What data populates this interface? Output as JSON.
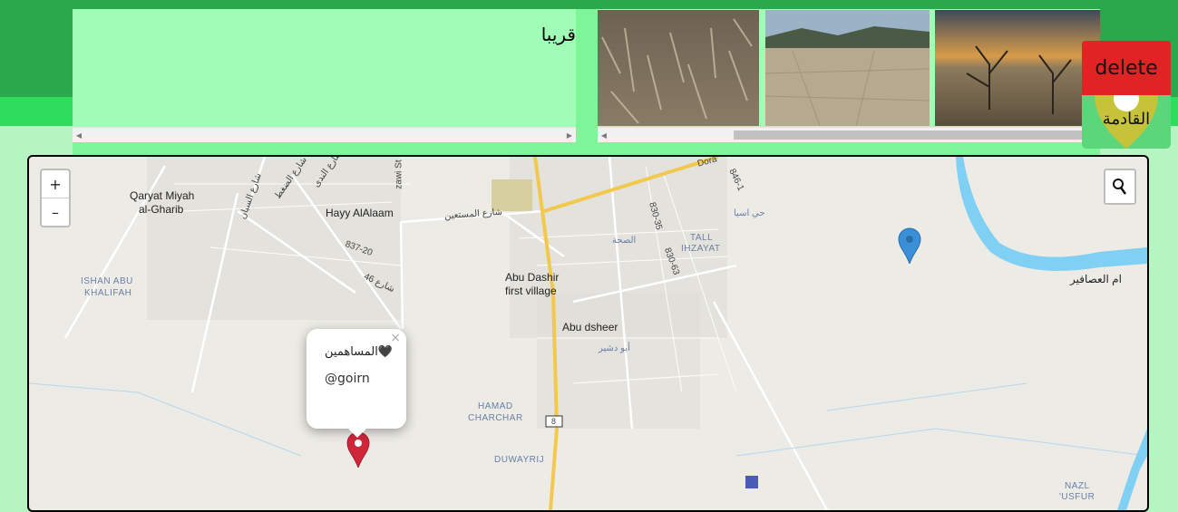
{
  "header": {
    "text_label": "قريبا",
    "delete_label": "delete",
    "coming_label": "القادمة"
  },
  "gallery": {
    "photos": [
      "dry-cracked-field-photo",
      "dry-lake-bed-photo",
      "dead-trees-sunset-photo"
    ]
  },
  "map": {
    "zoom_in": "+",
    "zoom_out": "–",
    "popup": {
      "close": "×",
      "title": "المساهمين🖤",
      "handle": "@goirn"
    },
    "labels": {
      "qaryat": "Qaryat Miyah",
      "qaryat2": "al-Gharib",
      "hayy": "Hayy AlAlaam",
      "abudashir": "Abu Dashir",
      "abudashir2": "first village",
      "abudsheer": "Abu dsheer",
      "abudsheer_ar": "أبو دشير",
      "ishan": "ISHAN ABU",
      "ishan2": "KHALIFAH",
      "hamad": "HAMAD",
      "hamad2": "CHARCHAR",
      "duwayrij": "DUWAYRIJ",
      "tall": "TALL",
      "tall2": "IHZAYAT",
      "safha": "الصحة",
      "hay_asia": "حي اسيا",
      "umm": "ام العصافير",
      "nazl": "NAZL",
      "nazl2": "'USFUR",
      "street_mustaeen": "شارع المستعين",
      "street_46": "شارع 46",
      "street_sassan": "شارع السبان",
      "street_daght": "شارع الضغط",
      "street_nida": "شارع الندى",
      "road_83720": "837-20",
      "road_83035": "830-35",
      "road_83063": "830-63",
      "road_8461": "846-1",
      "road_8": "8",
      "dora": "Dora",
      "zawi": "zawi St"
    }
  },
  "colors": {
    "top_band": "#2aa84c",
    "band2": "#2fdd5c",
    "page_bg": "#b6f5c2",
    "panel": "#7ff59a",
    "textbox": "#9ffdb6",
    "delete_bg": "#e02424",
    "marker_blue": "#3a8fd6",
    "marker_red": "#d0263a",
    "river": "#7fd0f2",
    "road_major": "#f2c94c"
  }
}
